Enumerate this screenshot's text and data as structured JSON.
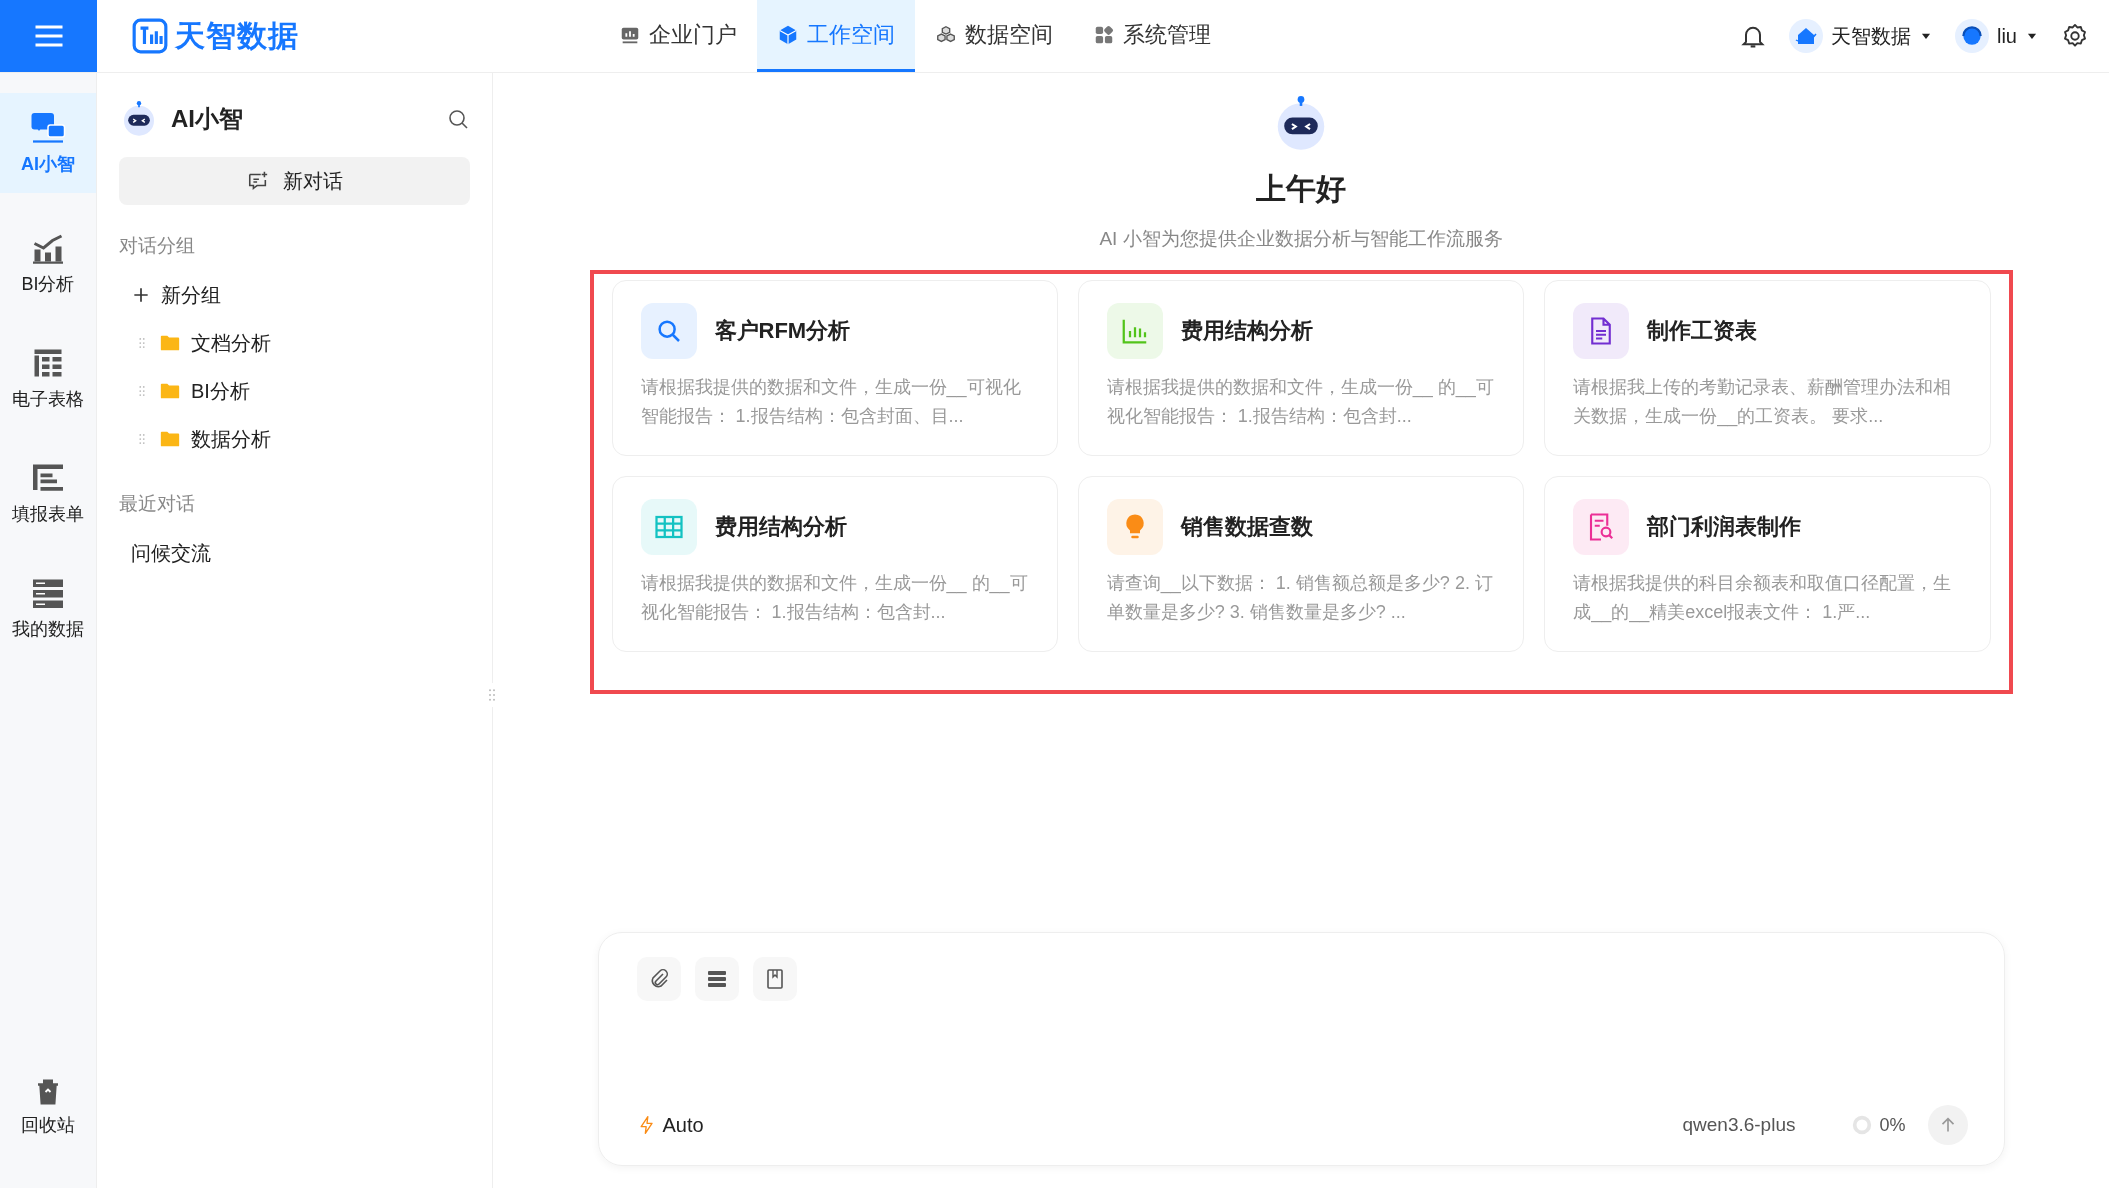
{
  "header": {
    "brand": "天智数据",
    "nav": [
      {
        "label": "企业门户",
        "selected": false
      },
      {
        "label": "工作空间",
        "selected": true
      },
      {
        "label": "数据空间",
        "selected": false
      },
      {
        "label": "系统管理",
        "selected": false
      }
    ],
    "org": "天智数据",
    "user": "liu"
  },
  "rail": {
    "items": [
      {
        "label": "AI小智",
        "selected": true
      },
      {
        "label": "BI分析",
        "selected": false
      },
      {
        "label": "电子表格",
        "selected": false
      },
      {
        "label": "填报表单",
        "selected": false
      },
      {
        "label": "我的数据",
        "selected": false
      }
    ],
    "trash": "回收站"
  },
  "sidebar": {
    "title": "AI小智",
    "new_chat": "新对话",
    "groups_heading": "对话分组",
    "new_group": "新分组",
    "groups": [
      "文档分析",
      "BI分析",
      "数据分析"
    ],
    "recent_heading": "最近对话",
    "recent": [
      "问候交流"
    ]
  },
  "main": {
    "greeting": "上午好",
    "subtitle": "AI 小智为您提供企业数据分析与智能工作流服务",
    "cards": [
      {
        "title": "客户RFM分析",
        "description": "请根据我提供的数据和文件，生成一份__可视化智能报告： 1.报告结构：包含封面、目...",
        "color": "#1677ff"
      },
      {
        "title": "费用结构分析",
        "description": "请根据我提供的数据和文件，生成一份__ 的__可视化智能报告： 1.报告结构：包含封...",
        "color": "#52c41a"
      },
      {
        "title": "制作工资表",
        "description": "请根据我上传的考勤记录表、薪酬管理办法和相关数据，生成一份__的工资表。 要求...",
        "color": "#722ed1"
      },
      {
        "title": "费用结构分析",
        "description": "请根据我提供的数据和文件，生成一份__ 的__可视化智能报告： 1.报告结构：包含封...",
        "color": "#13c2c2"
      },
      {
        "title": "销售数据查数",
        "description": "请查询__以下数据： 1. 销售额总额是多少? 2. 订单数量是多少? 3. 销售数量是多少? ...",
        "color": "#fa8c16"
      },
      {
        "title": "部门利润表制作",
        "description": "请根据我提供的科目余额表和取值口径配置，生成__的__精美excel报表文件： 1.严...",
        "color": "#eb2f96"
      }
    ],
    "composer": {
      "mode": "Auto",
      "model": "qwen3.6-plus",
      "usage": "0%",
      "level": 0
    }
  }
}
